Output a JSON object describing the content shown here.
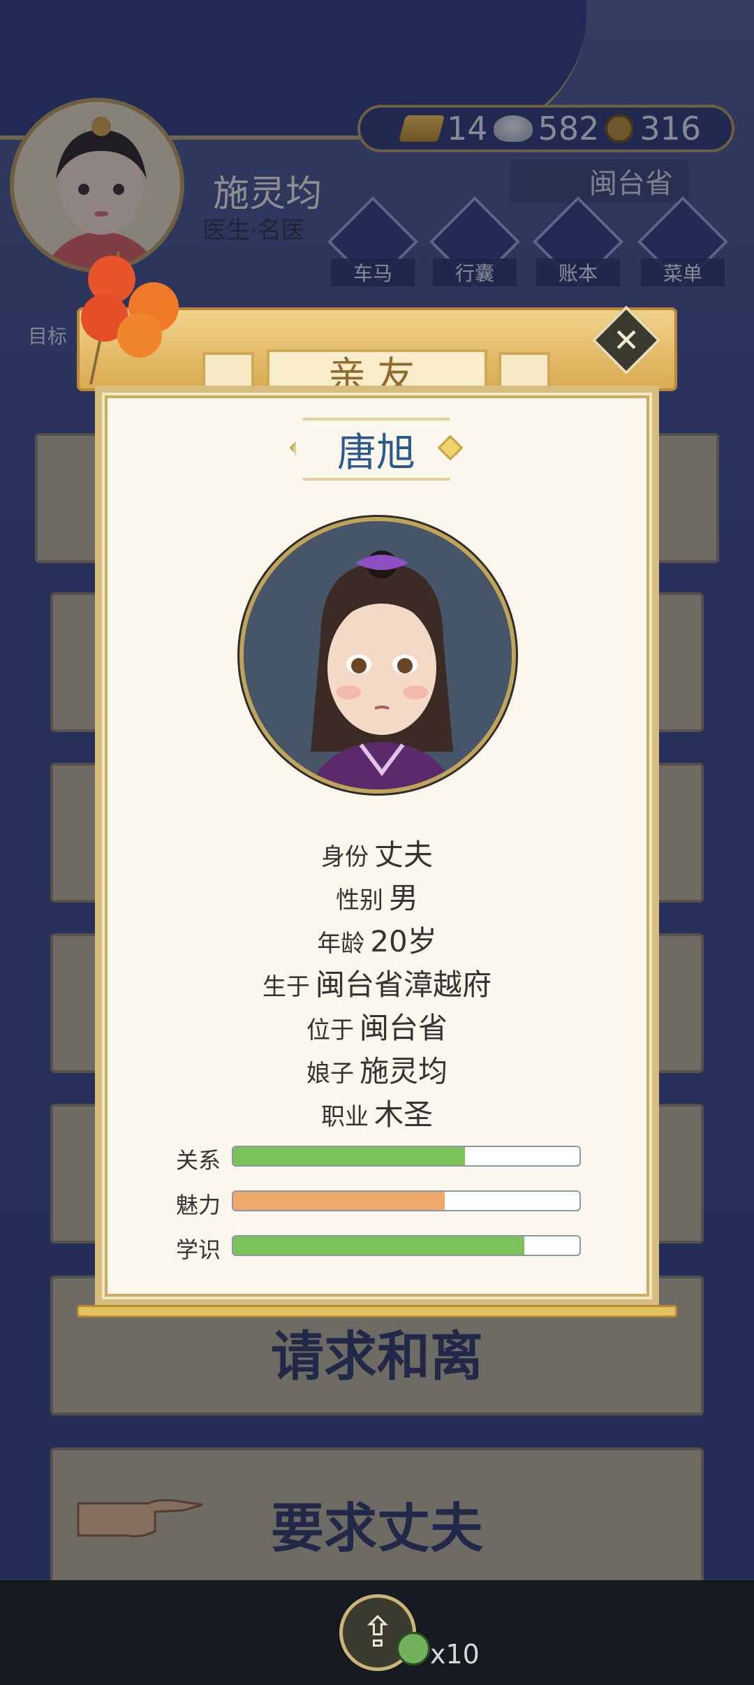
{
  "player": {
    "name": "施灵均",
    "title": "医生·名医",
    "goal_label": "目标"
  },
  "currency": {
    "gold": "14",
    "silver": "582",
    "coins": "316"
  },
  "location": {
    "province": "闽台省"
  },
  "nav": [
    {
      "label": "车马",
      "icon": "carriage-icon"
    },
    {
      "label": "行囊",
      "icon": "bag-icon",
      "badge": "!"
    },
    {
      "label": "账本",
      "icon": "ledger-icon"
    },
    {
      "label": "菜单",
      "icon": "menu-dots-icon"
    }
  ],
  "background_actions": {
    "divorce_label": "请求和离",
    "demand_husband_label": "要求丈夫"
  },
  "modal": {
    "title": "亲友",
    "close_symbol": "✕",
    "character": {
      "name": "唐旭",
      "fields": [
        {
          "key": "身份",
          "value": "丈夫"
        },
        {
          "key": "性别",
          "value": "男"
        },
        {
          "key": "年龄",
          "value": "20岁"
        },
        {
          "key": "生于",
          "value": "闽台省漳越府"
        },
        {
          "key": "位于",
          "value": "闽台省"
        },
        {
          "key": "娘子",
          "value": "施灵均"
        },
        {
          "key": "职业",
          "value": "木圣"
        }
      ],
      "stats": [
        {
          "key": "关系",
          "fraction": 0.67,
          "color": "#7cc35a"
        },
        {
          "key": "魅力",
          "fraction": 0.61,
          "color": "#f0a76b"
        },
        {
          "key": "学识",
          "fraction": 0.84,
          "color": "#7cc35a"
        }
      ]
    }
  },
  "bottom": {
    "share_count": "x10"
  }
}
